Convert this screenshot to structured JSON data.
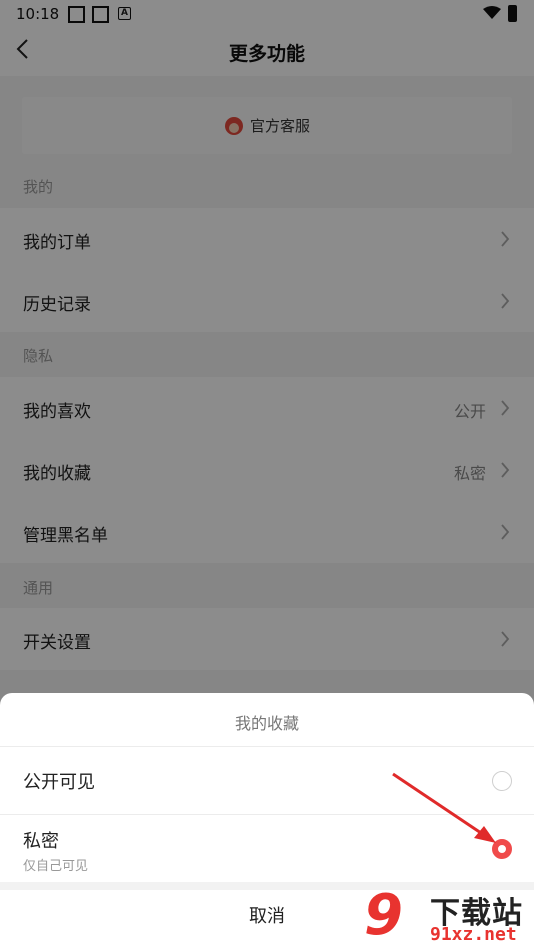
{
  "status_bar": {
    "time": "10:18",
    "notif_glyph": "A"
  },
  "header": {
    "title": "更多功能"
  },
  "service": {
    "label": "官方客服"
  },
  "sections": {
    "mine": "我的",
    "privacy": "隐私",
    "general": "通用"
  },
  "rows": {
    "orders": {
      "label": "我的订单"
    },
    "history": {
      "label": "历史记录"
    },
    "likes": {
      "label": "我的喜欢",
      "value": "公开"
    },
    "favorites": {
      "label": "我的收藏",
      "value": "私密"
    },
    "blacklist": {
      "label": "管理黑名单"
    },
    "switches": {
      "label": "开关设置"
    }
  },
  "sheet": {
    "title": "我的收藏",
    "option_public": {
      "label": "公开可见",
      "selected": false
    },
    "option_private": {
      "label": "私密",
      "sub": "仅自己可见",
      "selected": true
    },
    "cancel_label": "取消"
  },
  "watermark": {
    "brand_cn": "下载站",
    "url": "91xz.net",
    "digit": "9"
  },
  "colors": {
    "accent": "#f04b4b",
    "arrow": "#e02a2a"
  }
}
